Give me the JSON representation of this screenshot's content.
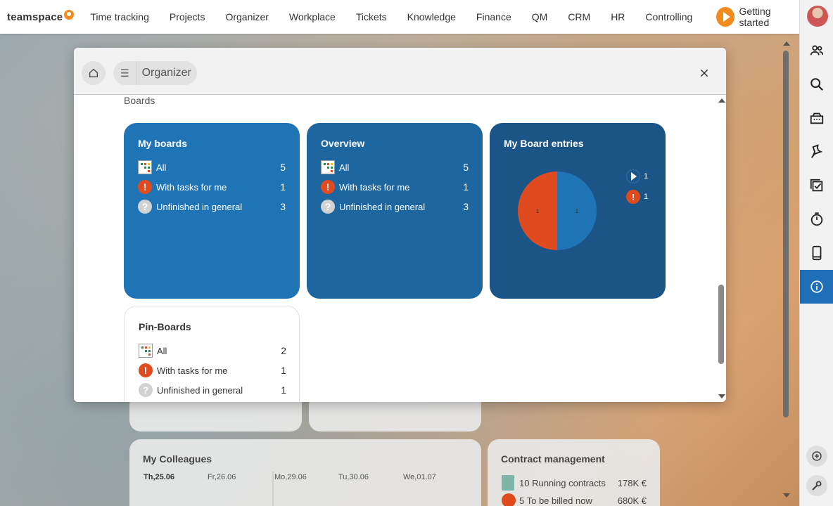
{
  "app": {
    "logo_text": "teamspace",
    "nav": [
      "Time tracking",
      "Projects",
      "Organizer",
      "Workplace",
      "Tickets",
      "Knowledge",
      "Finance",
      "QM",
      "CRM",
      "HR",
      "Controlling"
    ],
    "getting_started": "Getting started"
  },
  "sidebar": {
    "icons": [
      "avatar",
      "people-icon",
      "search-icon",
      "inbox-icon",
      "pin-icon",
      "tasks-icon",
      "stopwatch-icon",
      "mobile-icon",
      "info-icon",
      "add-icon",
      "wrench-icon"
    ],
    "active": "info-icon",
    "active_color": "#1e6fb8"
  },
  "modal": {
    "breadcrumb": "Organizer",
    "section_title": "Boards",
    "tiles": {
      "my_boards": {
        "title": "My boards",
        "rows": [
          {
            "label": "All",
            "count": "5"
          },
          {
            "label": "With tasks for me",
            "count": "1"
          },
          {
            "label": "Unfinished in general",
            "count": "3"
          }
        ]
      },
      "overview": {
        "title": "Overview",
        "rows": [
          {
            "label": "All",
            "count": "5"
          },
          {
            "label": "With tasks for me",
            "count": "1"
          },
          {
            "label": "Unfinished in general",
            "count": "3"
          }
        ]
      },
      "my_board_entries": {
        "title": "My Board entries",
        "legend": [
          {
            "icon": "play-icon",
            "value": "1"
          },
          {
            "icon": "exclamation-icon",
            "value": "1"
          }
        ]
      },
      "pin_boards": {
        "title": "Pin-Boards",
        "rows": [
          {
            "label": "All",
            "count": "2"
          },
          {
            "label": "With tasks for me",
            "count": "1"
          },
          {
            "label": "Unfinished in general",
            "count": "1"
          }
        ]
      }
    },
    "colors": {
      "my_boards": "#1f74b6",
      "overview": "#1d66a0",
      "entries": "#1b5486",
      "orange": "#e04a1f"
    }
  },
  "chart_data": {
    "type": "pie",
    "title": "",
    "slices": [
      {
        "label": "1",
        "value": 1,
        "color": "#1f74b6"
      },
      {
        "label": "1",
        "value": 1,
        "color": "#e04a1f"
      }
    ]
  },
  "background": {
    "colleagues": {
      "title": "My Colleagues",
      "days": [
        "Th,25.06",
        "Fr,26.06",
        "Mo,29.06",
        "Tu,30.06",
        "We,01.07"
      ]
    },
    "contracts": {
      "title": "Contract management",
      "rows": [
        {
          "label": "10 Running contracts",
          "value": "178K €"
        },
        {
          "label": "5 To be billed now",
          "value": "680K €"
        }
      ]
    }
  }
}
